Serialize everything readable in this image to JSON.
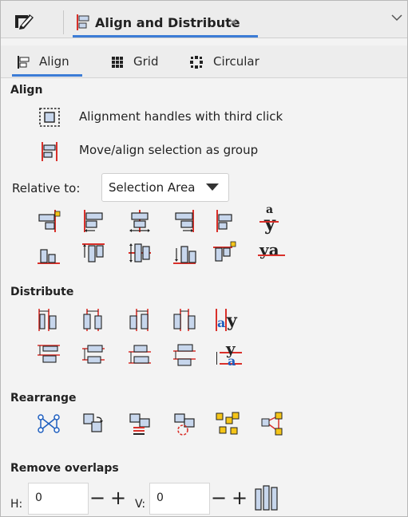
{
  "dock": {
    "tab_title": "Align and Distribute",
    "close_glyph": "×"
  },
  "subtabs": [
    {
      "label": "Align",
      "icon": "align-icon",
      "active": true
    },
    {
      "label": "Grid",
      "icon": "grid-icon",
      "active": false
    },
    {
      "label": "Circular",
      "icon": "circular-icon",
      "active": false
    }
  ],
  "align": {
    "title": "Align",
    "option_handles": "Alignment handles with third click",
    "option_group": "Move/align selection as group",
    "relative_label": "Relative to:",
    "relative_value": "Selection Area",
    "baseline_top_glyph": "a",
    "baseline_top_glyph2": "y",
    "baseline_bottom_glyph": "ya"
  },
  "distribute": {
    "title": "Distribute",
    "text_glyph_a": "a",
    "text_glyph_y": "y"
  },
  "rearrange": {
    "title": "Rearrange"
  },
  "remove_overlaps": {
    "title": "Remove overlaps",
    "h_label": "H:",
    "h_value": "0",
    "v_label": "V:",
    "v_value": "0",
    "minus": "−",
    "plus": "+"
  },
  "colors": {
    "accent": "#3c7cd6",
    "guide_red": "#d9302a",
    "shape_blue": "#c7d6ec",
    "shape_border": "#333333",
    "handle_yellow": "#f5c518",
    "node_blue": "#1f5fbf"
  }
}
